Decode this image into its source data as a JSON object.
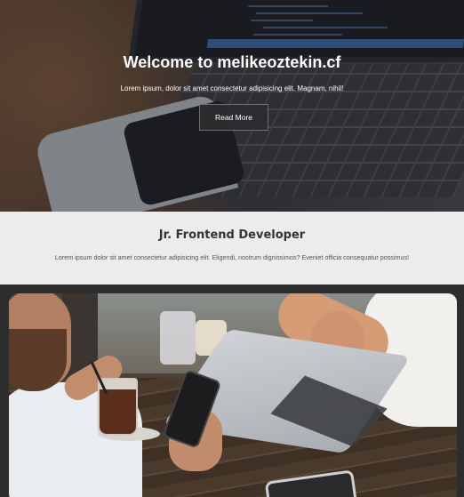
{
  "hero": {
    "title": "Welcome to melikeoztekin.cf",
    "subtitle": "Lorem ipsum, dolor sit amet consectetur adipisicing elit. Magnam, nihil!",
    "button_label": "Read More"
  },
  "info": {
    "title": "Jr. Frontend Developer",
    "text": "Lorem ipsum dolor sit amet consectetur adipisicing elit. Eligendi, nostrum dignissimos? Eveniet officia consequatur possimus!"
  },
  "colors": {
    "page_background": "#2d2d2d",
    "info_background": "#ececec",
    "button_background": "#2d2d30"
  }
}
